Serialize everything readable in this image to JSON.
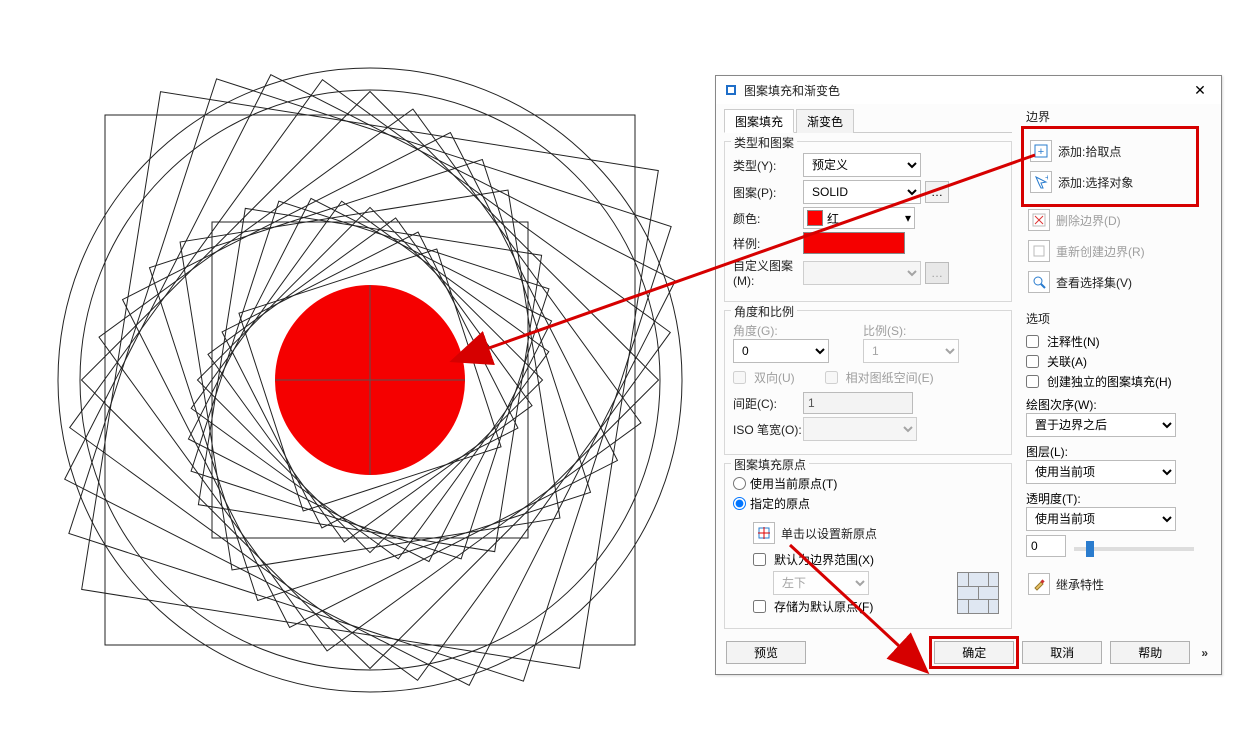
{
  "dialog": {
    "title": "图案填充和渐变色",
    "tabs": {
      "hatch": "图案填充",
      "gradient": "渐变色"
    },
    "type_pattern": {
      "group_title": "类型和图案",
      "type_label": "类型(Y):",
      "type_value": "预定义",
      "pattern_label": "图案(P):",
      "pattern_value": "SOLID",
      "color_label": "颜色:",
      "color_value": "红",
      "sample_label": "样例:",
      "custom_label": "自定义图案(M):"
    },
    "angle_scale": {
      "group_title": "角度和比例",
      "angle_label": "角度(G):",
      "angle_value": "0",
      "scale_label": "比例(S):",
      "scale_value": "1",
      "double_label": "双向(U)",
      "paperspace_label": "相对图纸空间(E)",
      "spacing_label": "间距(C):",
      "spacing_value": "1",
      "iso_label": "ISO 笔宽(O):"
    },
    "origin": {
      "group_title": "图案填充原点",
      "use_current": "使用当前原点(T)",
      "specified": "指定的原点",
      "click_set": "单击以设置新原点",
      "default_bounds": "默认为边界范围(X)",
      "default_pos": "左下",
      "store_default": "存储为默认原点(F)"
    },
    "boundary": {
      "title": "边界",
      "pickpoint": "添加:拾取点",
      "selectobj": "添加:选择对象",
      "remove": "删除边界(D)",
      "recreate": "重新创建边界(R)",
      "viewsel": "查看选择集(V)"
    },
    "options": {
      "title": "选项",
      "annotative": "注释性(N)",
      "assoc": "关联(A)",
      "separate": "创建独立的图案填充(H)",
      "draworder_label": "绘图次序(W):",
      "draworder_value": "置于边界之后",
      "layer_label": "图层(L):",
      "layer_value": "使用当前项",
      "transp_label": "透明度(T):",
      "transp_value": "使用当前项",
      "transp_num": "0",
      "inherit": "继承特性"
    },
    "footer": {
      "preview": "预览",
      "ok": "确定",
      "cancel": "取消",
      "help": "帮助"
    }
  }
}
